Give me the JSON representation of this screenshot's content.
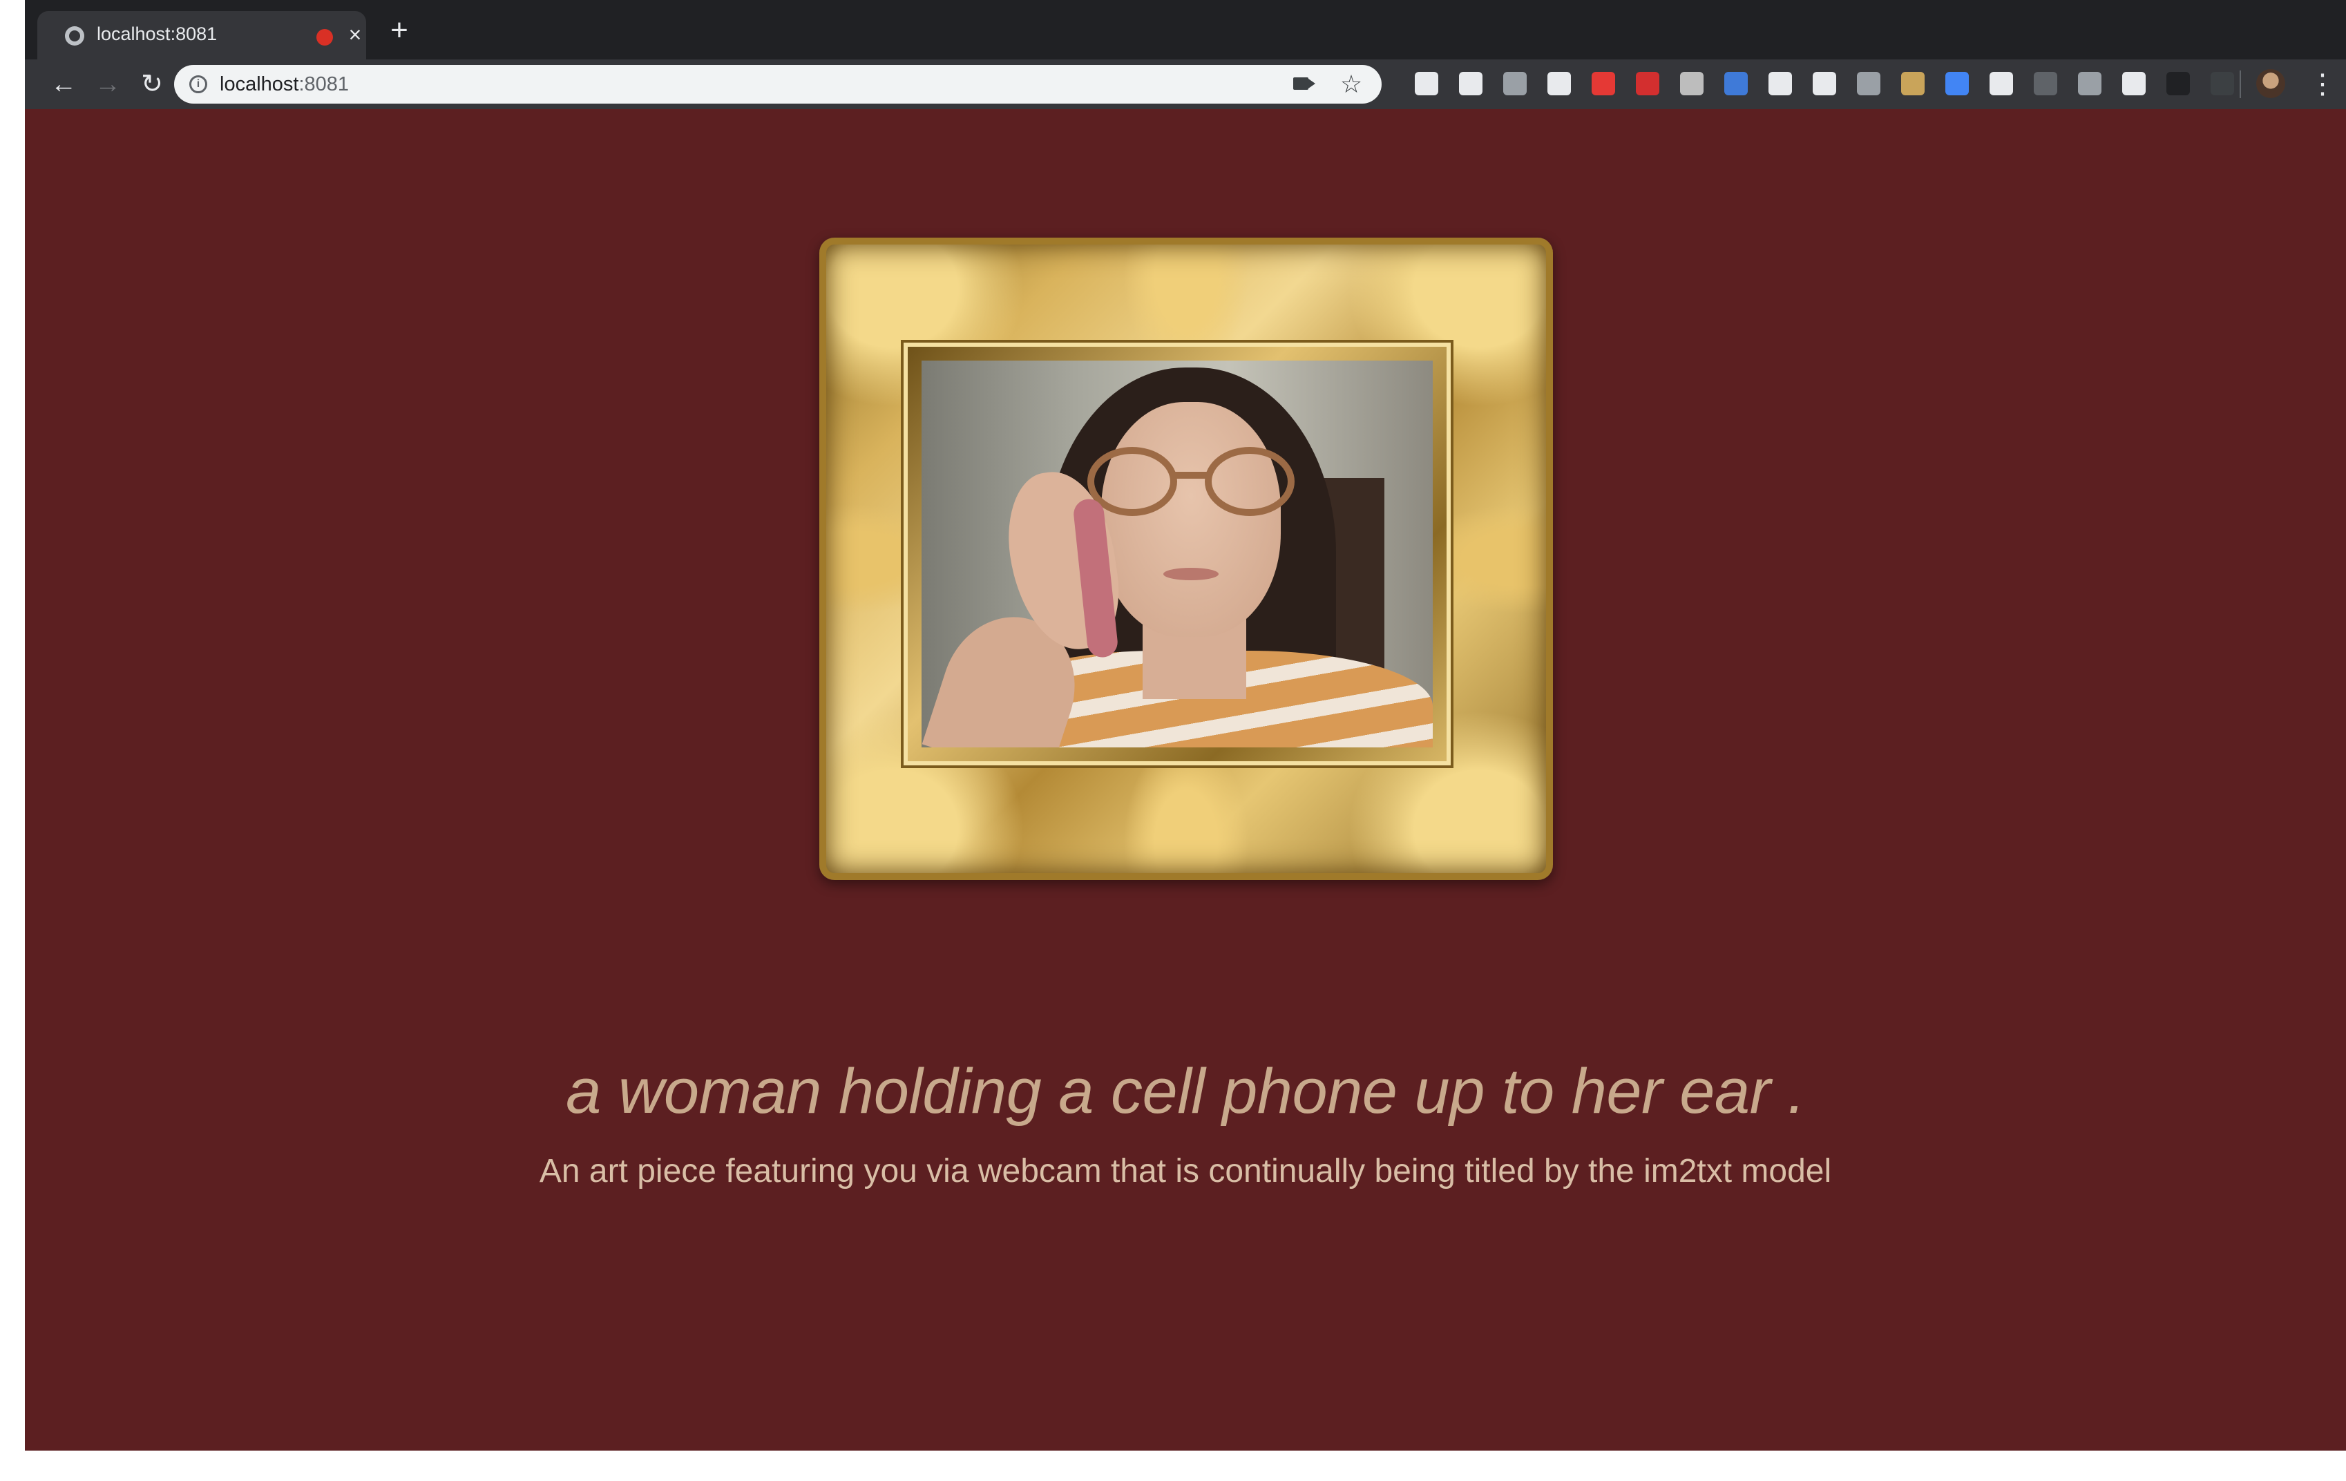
{
  "browser": {
    "tab": {
      "title": "localhost:8081",
      "favicon": "globe-icon",
      "recording_indicator": "record-icon",
      "close": "×"
    },
    "new_tab": "+",
    "nav": {
      "back": "←",
      "forward": "→",
      "reload": "↻",
      "menu": "⋮"
    },
    "address": {
      "host": "localhost",
      "port": ":8081",
      "info_icon": "i",
      "star": "☆"
    },
    "extension_colors": [
      "#e8eaed",
      "#e8eaed",
      "#9aa0a6",
      "#e8eaed",
      "#e53935",
      "#d32f2f",
      "#bdbdbd",
      "#3f7ad8",
      "#e8eaed",
      "#e8eaed",
      "#9aa0a6",
      "#c9a45a",
      "#4285f4",
      "#e8eaed",
      "#5f6368",
      "#9aa0a6",
      "#e8eaed",
      "#202124",
      "#3c4043"
    ]
  },
  "page": {
    "background": "#5c1f21",
    "caption": "a woman holding a cell phone up to her ear .",
    "subtitle": "An art piece featuring you via webcam that is continually being titled by the im2txt model"
  }
}
